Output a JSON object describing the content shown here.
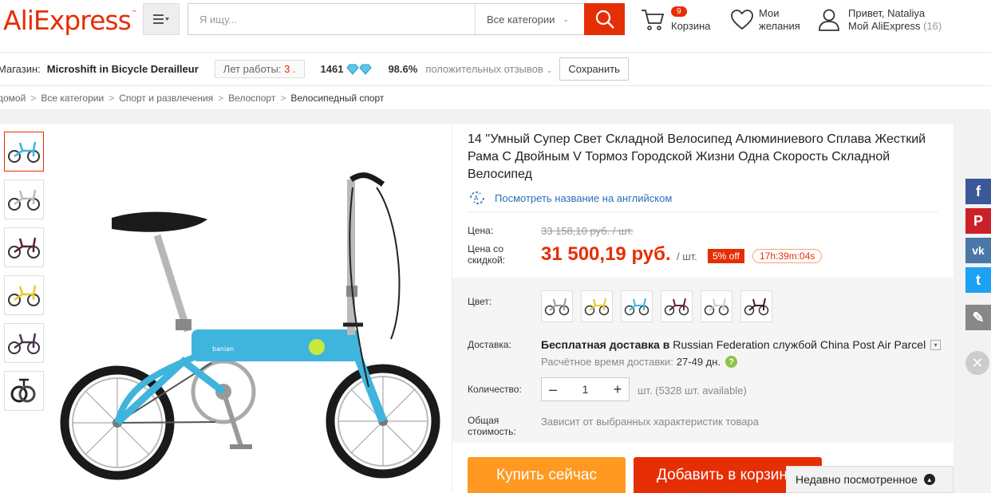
{
  "header": {
    "logo": "AliExpress",
    "logo_mark": "™",
    "search_placeholder": "Я ищу...",
    "search_category": "Все категории",
    "cart_count": "9",
    "cart_label": "Корзина",
    "wishlist_label": "Мои желания",
    "greeting": "Привет, Nataliya",
    "my_account": "Мой AliExpress",
    "my_account_count": "(16)"
  },
  "store": {
    "label": "Магазин:",
    "name": "Microshift in Bicycle Derailleur",
    "years_label": "Лет работы:",
    "years_value": "3 .",
    "score": "1461",
    "positive_pct": "98.6%",
    "positive_label": "положительных отзывов",
    "save_label": "Сохранить"
  },
  "breadcrumb": [
    "домой",
    "Все категории",
    "Спорт и развлечения",
    "Велоспорт",
    "Велосипедный спорт"
  ],
  "product": {
    "title": "14 ''Умный Супер Свет Складной Велосипед Алюминиевого Сплава Жесткий Рама С Двойным V Тормоз Городской Жизни Одна Скорость Складной Велосипед",
    "translate_link": "Посмотреть название на английском",
    "price_label": "Цена:",
    "old_price": "33 158,10 руб. / шт.",
    "sale_label": "Цена со скидкой:",
    "new_price": "31 500,19 руб.",
    "per_unit": "/ шт.",
    "discount": "5% off",
    "timer": "17h:39m:04s",
    "color_label": "Цвет:",
    "colors": [
      "white-grey",
      "yellow",
      "blue",
      "black-red",
      "silver",
      "black"
    ],
    "shipping_label": "Доставка:",
    "shipping_free": "Бесплатная доставка в",
    "shipping_country": "Russian Federation",
    "shipping_by": "службой",
    "shipping_service": "China Post Air Parcel",
    "delivery_time_label": "Расчётное время доставки:",
    "delivery_time": "27-49 дн.",
    "qty_label": "Количество:",
    "qty_value": "1",
    "qty_available": "шт. (5328 шт. available)",
    "total_label": "Общая стоимость:",
    "total_value": "Зависит от выбранных характеристик товара",
    "buy_now": "Купить сейчас",
    "add_to_cart": "Добавить в корзину"
  },
  "recent": "Недавно посмотренное",
  "social": {
    "facebook": "f",
    "pinterest": "P",
    "vk": "vk",
    "twitter": "t",
    "edit": "✎",
    "close": "✕"
  },
  "colors": {
    "brand": "#e62e04",
    "buy": "#ff9922",
    "facebook": "#3b5998",
    "pinterest": "#cb2027",
    "vk": "#4a76a8",
    "twitter": "#1da1f2",
    "edit": "#888888"
  }
}
